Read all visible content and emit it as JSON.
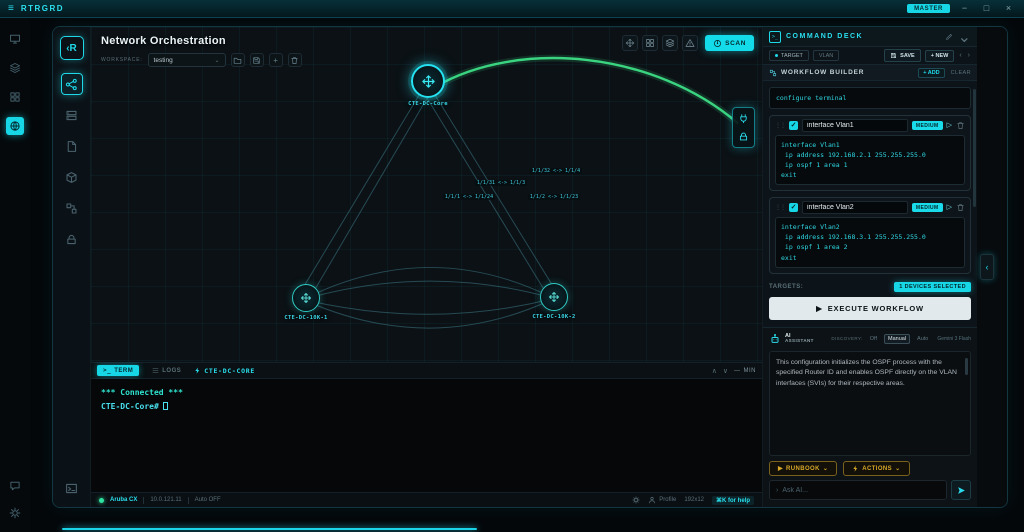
{
  "icons": {
    "menu": "≡",
    "minimize": "−",
    "maximize": "□",
    "close": "×",
    "caret_down": "⌄",
    "chevron_left": "‹",
    "chevron_right": "›",
    "chevron_up": "∧",
    "chevron_down": "∨",
    "collapse_left": "‹",
    "play": "▶",
    "play_outline": "▷",
    "drag_handle": "⋮⋮",
    "check": "✓",
    "dash": "—",
    "plus": "+",
    "prompt": ">_",
    "ask_prompt": "›"
  },
  "titlebar": {
    "app_name": "RTRGRD",
    "badge": "MASTER"
  },
  "sidebar": {
    "logo": "‹R"
  },
  "canvas": {
    "title": "Network Orchestration",
    "workspace_label": "WORKSPACE:",
    "workspace_value": "testing",
    "scan_label": "SCAN",
    "nodes": [
      {
        "label": "CTE-DC-Core"
      },
      {
        "label": "CTE-DC-10K-1"
      },
      {
        "label": "CTE-DC-10K-2"
      }
    ],
    "edge_labels": [
      {
        "label": "1/1/32 <-> 1/1/4"
      },
      {
        "label": "1/1/31 <-> 1/1/3"
      },
      {
        "label": "1/1/1 <-> 1/1/24"
      },
      {
        "label": "1/1/2 <-> 1/1/23"
      }
    ]
  },
  "terminal": {
    "tab_term": "TERM",
    "tab_logs": "LOGS",
    "session": "CTE-DC-CORE",
    "min_label": "MIN",
    "connected_line": "*** Connected ***",
    "prompt": "CTE-DC-Core#"
  },
  "statusbar": {
    "platform": "Aruba CX",
    "ip": "10.0.121.11",
    "auto_mode": "Auto OFF",
    "profile": "Profile",
    "term_size": "192x12",
    "help": "⌘K for help"
  },
  "command_deck": {
    "title": "COMMAND DECK",
    "tab_target": "TARGET",
    "tab_vlan": "VLAN",
    "save_label": "SAVE",
    "new_label": "+ NEW",
    "workflow": {
      "title": "WORKFLOW BUILDER",
      "add_label": "+ ADD",
      "clear_label": "CLEAR",
      "base_command": "configure terminal",
      "steps": [
        {
          "name": "interface Vlan1",
          "priority": "MEDIUM",
          "code": "interface Vlan1\n ip address 192.168.2.1 255.255.255.0\n ip ospf 1 area 1\nexit"
        },
        {
          "name": "interface Vlan2",
          "priority": "MEDIUM",
          "code": "interface Vlan2\n ip address 192.168.3.1 255.255.255.0\n ip ospf 1 area 2\nexit"
        }
      ],
      "targets_label": "TARGETS:",
      "targets_value": "1 DEVICES SELECTED",
      "execute_label": "EXECUTE WORKFLOW"
    },
    "ai": {
      "title_top": "AI",
      "title_bottom": "ASSISTANT",
      "discovery_label": "DISCOVERY:",
      "mode_off": "Off",
      "mode_manual": "Manual",
      "mode_auto": "Auto",
      "model": "Gemini 3 Flash",
      "message": "This configuration initializes the OSPF process with the specified Router ID and enables OSPF directly on the VLAN interfaces (SVIs) for their respective areas.",
      "runbook_label": "RUNBOOK",
      "actions_label": "ACTIONS",
      "ask_placeholder": "Ask AI..."
    }
  },
  "colors": {
    "accent": "#1fd9e9",
    "link_green": "#3ddc84",
    "amber": "#d8a827"
  }
}
